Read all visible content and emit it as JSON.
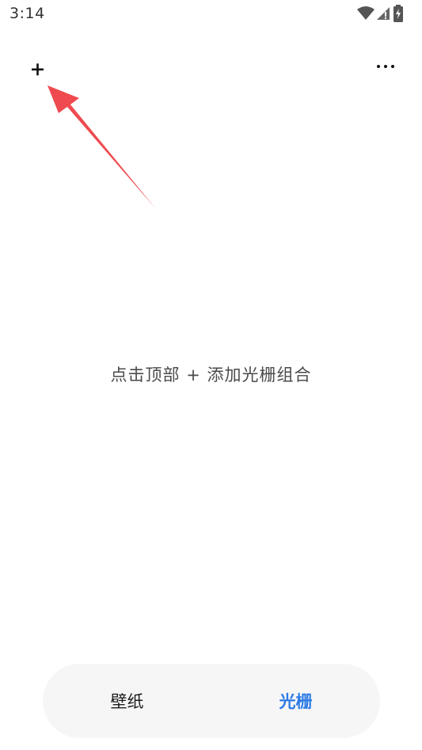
{
  "status_bar": {
    "time": "3:14",
    "icons": [
      "wifi-icon",
      "cellular-signal-icon",
      "battery-charging-icon"
    ]
  },
  "toolbar": {
    "add_icon": "plus-icon",
    "more_icon": "more-horizontal-icon"
  },
  "empty_state": {
    "hint": "点击顶部 + 添加光栅组合"
  },
  "bottom_nav": {
    "tabs": [
      {
        "label": "壁纸",
        "selected": false
      },
      {
        "label": "光栅",
        "selected": true
      }
    ]
  },
  "colors": {
    "accent": "#2e7be6",
    "annotation_arrow": "#ee4a4f",
    "nav_background": "#f6f6f6"
  }
}
